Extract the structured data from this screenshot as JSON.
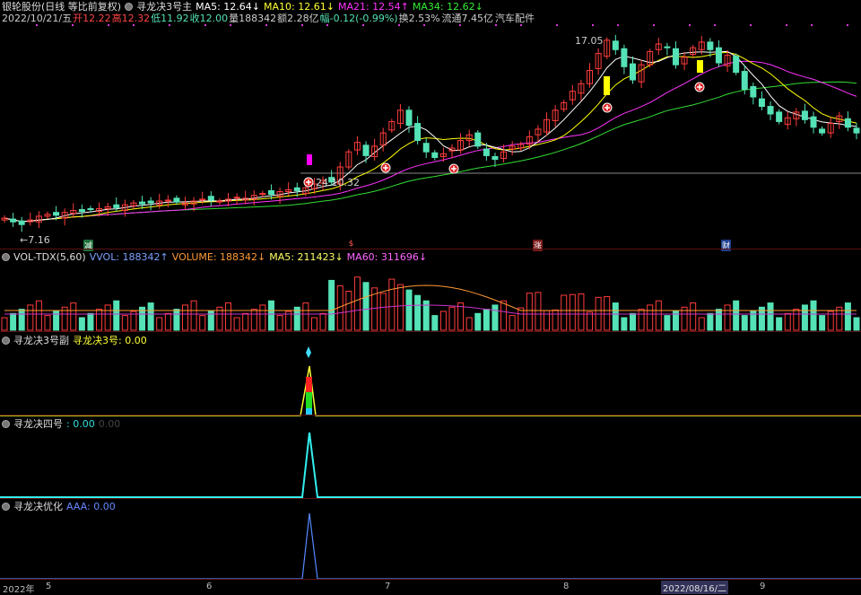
{
  "header": {
    "title": "银轮股份(日线 等比前复权)",
    "indicator_name": "寻龙决3号主",
    "ma5": "MA5: 12.64↓",
    "ma10": "MA10: 12.61↓",
    "ma21": "MA21: 12.54↑",
    "ma34": "MA34: 12.62↓"
  },
  "quote": {
    "date": "2022/10/21/五",
    "open": "开12.22",
    "high": "高12.32",
    "low": "低11.92",
    "close": "收12.00",
    "volume": "量188342",
    "amount": "额2.28亿",
    "change": "幅-0.12(-0.99%)",
    "turnover": "换2.53%",
    "float": "流通7.45亿",
    "sector": "汽车配件"
  },
  "price_annotations": {
    "high_label": "17.05",
    "low_label": "←7.16",
    "mid_label": "24 10.32"
  },
  "events": [
    "减",
    "$",
    "涨",
    "财"
  ],
  "volume_panel": {
    "name": "VOL-TDX(5,60)",
    "vvol": "VVOL: 188342↑",
    "volume": "VOLUME: 188342↓",
    "ma5": "MA5: 211423↓",
    "ma60": "MA60: 311696↓"
  },
  "panel3": {
    "name": "寻龙决3号副",
    "value": "寻龙决3号: 0.00"
  },
  "panel4": {
    "name": "寻龙决四号",
    "value": ": 0.00",
    "value2": "0.00"
  },
  "panel5": {
    "name": "寻龙决优化",
    "value": "AAA: 0.00"
  },
  "time_axis": {
    "labels": [
      "2022年",
      "5",
      "6",
      "7",
      "8",
      "9"
    ],
    "highlight": "2022/08/16/二"
  },
  "colors": {
    "up": "#ff3c3c",
    "down": "#54e2b6",
    "ma5": "#ffffff",
    "ma10": "#ffff00",
    "ma21": "#ff33ff",
    "ma34": "#33dd33",
    "background": "#000000"
  },
  "price_series": [
    7.5,
    7.3,
    7.16,
    7.4,
    7.6,
    7.7,
    7.65,
    7.8,
    7.9,
    7.85,
    7.95,
    8.0,
    8.1,
    8.05,
    8.2,
    8.3,
    8.25,
    8.3,
    8.4,
    8.45,
    8.35,
    8.3,
    8.4,
    8.5,
    8.45,
    8.4,
    8.5,
    8.6,
    8.55,
    8.7,
    8.8,
    8.75,
    8.9,
    9.0,
    8.95,
    9.1,
    9.3,
    9.5,
    9.4,
    10.2,
    11.0,
    11.5,
    10.8,
    11.3,
    12.0,
    12.6,
    13.2,
    12.4,
    11.6,
    11.0,
    10.7,
    10.9,
    11.2,
    11.6,
    11.9,
    11.3,
    10.8,
    10.6,
    11.0,
    11.3,
    11.4,
    11.8,
    12.2,
    12.7,
    13.2,
    13.6,
    14.2,
    14.6,
    15.3,
    16.2,
    16.9,
    16.4,
    15.5,
    14.8,
    15.6,
    16.3,
    16.7,
    16.5,
    15.6,
    16.0,
    16.5,
    16.8,
    16.4,
    15.7,
    16.1,
    15.2,
    14.3,
    13.9,
    13.4,
    13.0,
    12.6,
    12.8,
    13.1,
    12.7,
    12.3,
    12.0,
    12.5,
    12.9,
    12.3,
    12.0
  ]
}
